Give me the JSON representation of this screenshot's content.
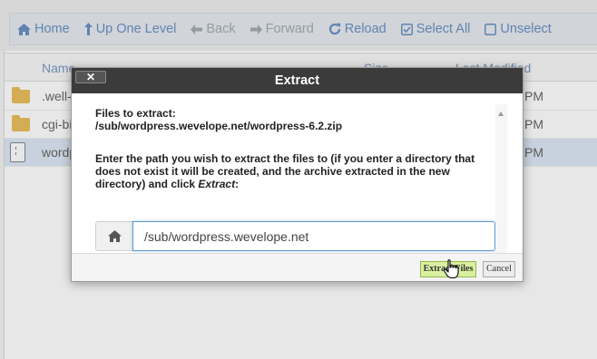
{
  "toolbar": {
    "home": "Home",
    "up_one_level": "Up One Level",
    "back": "Back",
    "forward": "Forward",
    "reload": "Reload",
    "select_all": "Select All",
    "unselect": "Unselect"
  },
  "file_list": {
    "headers": {
      "name": "Name",
      "size": "Size",
      "last_modified": "Last Modified"
    },
    "rows": [
      {
        "name": ".well-",
        "time": "PM",
        "icon": "folder-icon"
      },
      {
        "name": "cgi-bi",
        "time": "PM",
        "icon": "folder-icon"
      },
      {
        "name": "wordp",
        "time": "PM",
        "icon": "zip-icon",
        "selected": true
      }
    ]
  },
  "dialog": {
    "title": "Extract",
    "close_label": "✕",
    "files_label": "Files to extract:",
    "file_path": "/sub/wordpress.wevelope.net/wordpress-6.2.zip",
    "instructions_line1": "Enter the path you wish to extract the files to (if you enter a directory that",
    "instructions_line2": "does not exist it will be created, and the archive extracted in the new",
    "instructions_line3_prefix": "directory) and click ",
    "instructions_line3_emph": "Extract",
    "instructions_line3_suffix": ":",
    "path_value": "/sub/wordpress.wevelope.net",
    "extract_button": "Extract Files",
    "cancel_button": "Cancel"
  },
  "colors": {
    "toolbar_link": "#5a87bf",
    "title_bar": "#3b3b3b",
    "extract_button_bg": "#d8f0a0",
    "input_focus": "#5b9bd5"
  }
}
